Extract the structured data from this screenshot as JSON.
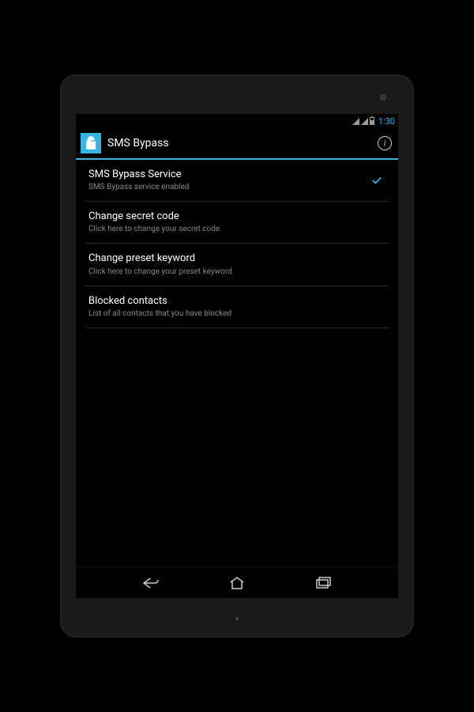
{
  "statusBar": {
    "time": "1:30"
  },
  "appBar": {
    "title": "SMS Bypass"
  },
  "settings": [
    {
      "title": "SMS Bypass Service",
      "subtitle": "SMS Bypass service enabled",
      "checked": true
    },
    {
      "title": "Change secret code",
      "subtitle": "Click here to change your secret code"
    },
    {
      "title": "Change preset keyword",
      "subtitle": "Click here to change your preset keyword"
    },
    {
      "title": "Blocked contacts",
      "subtitle": "List of all contacts that you have blocked"
    }
  ]
}
